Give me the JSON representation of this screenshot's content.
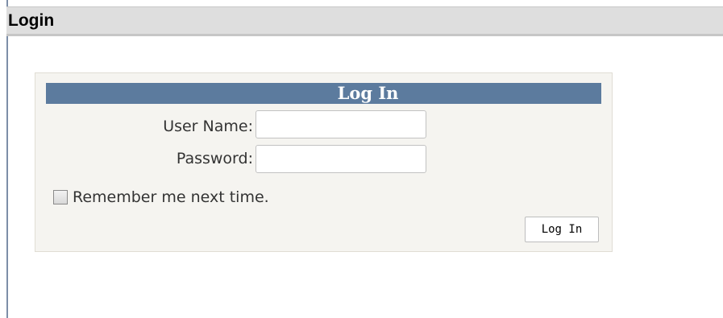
{
  "header": {
    "title": "Login"
  },
  "login_panel": {
    "title": "Log In",
    "username_label": "User Name:",
    "username_value": "",
    "password_label": "Password:",
    "password_value": "",
    "remember_label": "Remember me next time.",
    "remember_checked": false,
    "submit_label": "Log In"
  },
  "colors": {
    "panel_title_bg": "#5c7b9e",
    "header_bg": "#dedede",
    "panel_bg": "#f5f4f0"
  }
}
